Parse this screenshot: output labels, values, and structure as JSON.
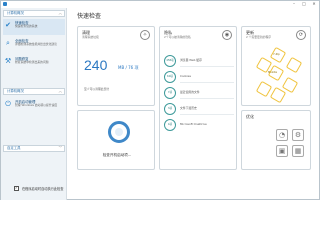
{
  "window": {
    "title": "",
    "min": "–",
    "max": "□",
    "close": "✕"
  },
  "page_title": "快速检查",
  "sidebar": {
    "sections": [
      {
        "label": "计算机概况"
      },
      {
        "label": "计算机概况"
      },
      {
        "label": "自定工具"
      }
    ],
    "items": [
      {
        "title": "快速检查",
        "desc": "快速检查您的系统"
      },
      {
        "title": "全面检查",
        "desc": "详细检测系统性能并给出优化建议"
      },
      {
        "title": "问题修复",
        "desc": "修复系统中检测出来的问题"
      },
      {
        "title": "开机启动管理",
        "desc": "管理 Windows 启动项以提升速度"
      }
    ]
  },
  "cards": {
    "clean": {
      "title": "清理",
      "subtitle": "清理系统垃圾",
      "big": "240",
      "unit": "MB / 76 项",
      "foot": "至少可以清理此部分"
    },
    "boot": {
      "label": "检查开机启动项..."
    },
    "privacy": {
      "title": "隐私",
      "subtitle": "2个可以被清除的隐私",
      "rows": [
        {
          "badge": "458项",
          "label": "浏览器 Web 缓存"
        },
        {
          "badge": "60项",
          "label": "Cookies"
        },
        {
          "badge": "7项",
          "label": "最近使用的文件"
        },
        {
          "badge": "3项",
          "label": "文件下载历史"
        },
        {
          "badge": "4项",
          "label": "Microsoft OneDrive"
        }
      ]
    },
    "update": {
      "title": "更新",
      "subtitle": "2 个需要更新的程序",
      "hexes": [
        "7-Zip",
        "",
        "Mozilla"
      ]
    },
    "optimize": {
      "title": "优化"
    },
    "link": "详细信息"
  },
  "bottom": {
    "check": "✓",
    "label": "在程序启动时自动执行此检查"
  }
}
